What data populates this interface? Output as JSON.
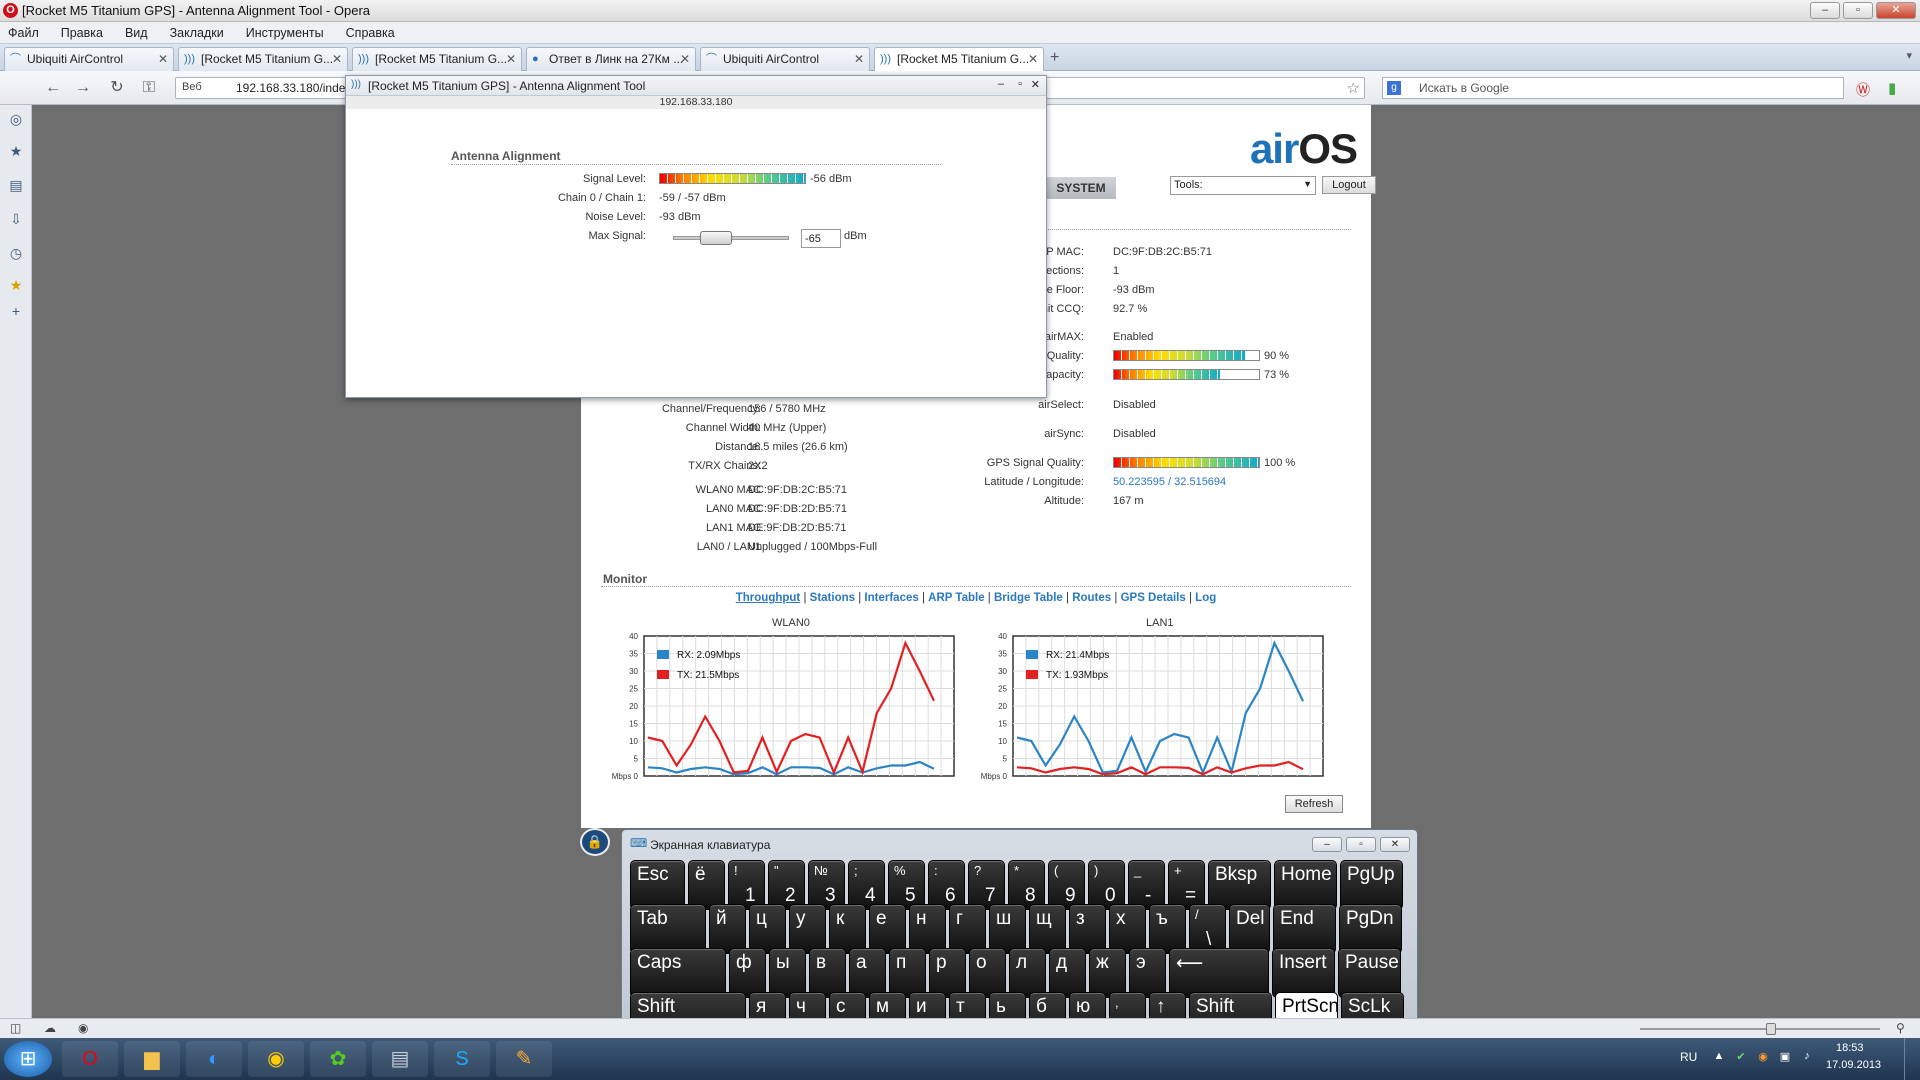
{
  "window": {
    "title": "[Rocket M5 Titanium GPS] - Antenna Alignment Tool - Opera",
    "min": "–",
    "max": "▫",
    "close": "✕"
  },
  "menu": [
    "Файл",
    "Правка",
    "Вид",
    "Закладки",
    "Инструменты",
    "Справка"
  ],
  "tabs": [
    {
      "label": "Ubiquiti AirControl"
    },
    {
      "label": "[Rocket M5 Titanium G..."
    },
    {
      "label": "[Rocket M5 Titanium G..."
    },
    {
      "label": "Ответ в Линк на 27Км ..."
    },
    {
      "label": "Ubiquiti AirControl"
    },
    {
      "label": "[Rocket M5 Titanium G..."
    }
  ],
  "address": {
    "badge": "Веб",
    "url": "192.168.33.180/inde",
    "search_placeholder": "Искать в Google"
  },
  "airos": {
    "logo_a": "air",
    "logo_b": "OS",
    "tab_system": "SYSTEM",
    "tools": "Tools:",
    "logout": "Logout",
    "right_labels": [
      "AP MAC:",
      "onnections:",
      "loise Floor:",
      "ansmit CCQ:",
      "airMAX:",
      "AX Quality:",
      "X Capacity:",
      "airSelect:",
      "airSync:",
      "GPS Signal Quality:",
      "Latitude / Longitude:",
      "Altitude:"
    ],
    "right_values": [
      "DC:9F:DB:2C:B5:71",
      "1",
      "-93 dBm",
      "92.7 %",
      "Enabled",
      "90 %",
      "73 %",
      "Disabled",
      "Disabled",
      "100 %",
      "50.223595 / 32.515694",
      "167 m"
    ],
    "left_labels": [
      "Channel/Frequency:",
      "Channel Width:",
      "Distance:",
      "TX/RX Chains:",
      "WLAN0 MAC",
      "LAN0 MAC",
      "LAN1 MAC",
      "LAN0 / LAN1"
    ],
    "left_values": [
      "156 / 5780 MHz",
      "40 MHz (Upper)",
      "16.5 miles (26.6 km)",
      "2X2",
      "DC:9F:DB:2C:B5:71",
      "DC:9F:DB:2D:B5:71",
      "DE:9F:DB:2D:B5:71",
      "Unplugged / 100Mbps-Full"
    ],
    "levels": {
      "airmax_quality": 0.9,
      "airmax_capacity": 0.73,
      "gps_quality": 1.0
    },
    "monitor": "Monitor",
    "links": [
      "Throughput",
      "Stations",
      "Interfaces",
      "ARP Table",
      "Bridge Table",
      "Routes",
      "GPS Details",
      "Log"
    ],
    "refresh": "Refresh"
  },
  "popup": {
    "title": "[Rocket M5 Titanium GPS] - Antenna Alignment Tool",
    "ip": "192.168.33.180",
    "section": "Antenna Alignment",
    "labels": [
      "Signal Level:",
      "Chain 0 / Chain 1:",
      "Noise Level:",
      "Max Signal:"
    ],
    "values": [
      "-56 dBm",
      "-59 / -57 dBm",
      "-93 dBm",
      ""
    ],
    "signal_level": 1.0,
    "max_value": "-65",
    "unit": "dBm"
  },
  "keyboard": {
    "title": "Экранная клавиатура",
    "rows": [
      [
        {
          "m": "Esc",
          "w": 55
        },
        {
          "m": "ё",
          "w": 37
        },
        {
          "s": "!",
          "b": "1",
          "w": 37
        },
        {
          "s": "\"",
          "b": "2",
          "w": 37
        },
        {
          "s": "№",
          "b": "3",
          "w": 37
        },
        {
          "s": ";",
          "b": "4",
          "w": 37
        },
        {
          "s": "%",
          "b": "5",
          "w": 37
        },
        {
          "s": ":",
          "b": "6",
          "w": 37
        },
        {
          "s": "?",
          "b": "7",
          "w": 37
        },
        {
          "s": "*",
          "b": "8",
          "w": 37
        },
        {
          "s": "(",
          "b": "9",
          "w": 37
        },
        {
          "s": ")",
          "b": "0",
          "w": 37
        },
        {
          "s": "_",
          "b": "-",
          "w": 37
        },
        {
          "s": "+",
          "b": "=",
          "w": 37
        },
        {
          "m": "Bksp",
          "w": 63
        },
        {
          "m": "Home",
          "w": 63
        },
        {
          "m": "PgUp",
          "w": 63
        }
      ],
      [
        {
          "m": "Tab",
          "w": 76
        },
        {
          "m": "й",
          "w": 37
        },
        {
          "m": "ц",
          "w": 37
        },
        {
          "m": "у",
          "w": 37
        },
        {
          "m": "к",
          "w": 37
        },
        {
          "m": "е",
          "w": 37
        },
        {
          "m": "н",
          "w": 37
        },
        {
          "m": "г",
          "w": 37
        },
        {
          "m": "ш",
          "w": 37
        },
        {
          "m": "щ",
          "w": 37
        },
        {
          "m": "з",
          "w": 37
        },
        {
          "m": "х",
          "w": 37
        },
        {
          "m": "ъ",
          "w": 37
        },
        {
          "s": "/",
          "b": "\\",
          "w": 37
        },
        {
          "m": "Del",
          "w": 41
        },
        {
          "m": "End",
          "w": 63
        },
        {
          "m": "PgDn",
          "w": 63
        }
      ],
      [
        {
          "m": "Caps",
          "w": 96
        },
        {
          "m": "ф",
          "w": 37
        },
        {
          "m": "ы",
          "w": 37
        },
        {
          "m": "в",
          "w": 37
        },
        {
          "m": "а",
          "w": 37
        },
        {
          "m": "п",
          "w": 37
        },
        {
          "m": "р",
          "w": 37
        },
        {
          "m": "о",
          "w": 37
        },
        {
          "m": "л",
          "w": 37
        },
        {
          "m": "д",
          "w": 37
        },
        {
          "m": "ж",
          "w": 37
        },
        {
          "m": "э",
          "w": 37
        },
        {
          "m": "⟵",
          "w": 100
        },
        {
          "m": "Insert",
          "w": 63
        },
        {
          "m": "Pause",
          "w": 63
        }
      ],
      [
        {
          "m": "Shift",
          "w": 116
        },
        {
          "m": "я",
          "w": 37
        },
        {
          "m": "ч",
          "w": 37
        },
        {
          "m": "с",
          "w": 37
        },
        {
          "m": "м",
          "w": 37
        },
        {
          "m": "и",
          "w": 37
        },
        {
          "m": "т",
          "w": 37
        },
        {
          "m": "ь",
          "w": 37
        },
        {
          "m": "б",
          "w": 37
        },
        {
          "m": "ю",
          "w": 37
        },
        {
          "s": ",",
          "b": ".",
          "w": 37
        },
        {
          "m": "↑",
          "w": 37
        },
        {
          "m": "Shift",
          "w": 83
        },
        {
          "m": "PrtScn",
          "w": 63,
          "white": true
        },
        {
          "m": "ScLk",
          "w": 63
        }
      ]
    ]
  },
  "tray": {
    "lang": "RU",
    "time": "18:53",
    "date": "17.09.2013"
  },
  "colors": {
    "rx": "#2a84c6",
    "tx": "#e32020",
    "accent": "#1d72b8"
  },
  "chart_data": [
    {
      "type": "line",
      "title": "WLAN0",
      "ylabel": "Mbps",
      "ylim": [
        0,
        40
      ],
      "yticks": [
        0,
        5,
        10,
        15,
        20,
        25,
        30,
        35,
        40
      ],
      "series": [
        {
          "name": "RX: 2.09Mbps",
          "values": [
            2.5,
            2.2,
            1,
            2,
            2.5,
            2,
            0.5,
            0.8,
            2.5,
            0.5,
            2.5,
            2.5,
            2.3,
            0.5,
            2.5,
            1,
            2.2,
            3,
            3,
            4,
            2.1
          ]
        },
        {
          "name": "TX: 21.5Mbps",
          "values": [
            11,
            10,
            3,
            9,
            17,
            10,
            1,
            1.5,
            11,
            1.2,
            10,
            12,
            11,
            1,
            11,
            1.2,
            18,
            25,
            38,
            30,
            21.5
          ]
        }
      ]
    },
    {
      "type": "line",
      "title": "LAN1",
      "ylabel": "Mbps",
      "ylim": [
        0,
        40
      ],
      "yticks": [
        0,
        5,
        10,
        15,
        20,
        25,
        30,
        35,
        40
      ],
      "series": [
        {
          "name": "RX: 21.4Mbps",
          "values": [
            11,
            10,
            3,
            9,
            17,
            10,
            1,
            1.5,
            11,
            1.2,
            10,
            12,
            11,
            1,
            11,
            1.2,
            18,
            25,
            38,
            30,
            21.4
          ]
        },
        {
          "name": "TX: 1.93Mbps",
          "values": [
            2.5,
            2.2,
            1,
            2,
            2.5,
            2,
            0.5,
            0.8,
            2.5,
            0.5,
            2.5,
            2.5,
            2.3,
            0.5,
            2.5,
            1,
            2.2,
            3,
            3,
            4,
            1.93
          ]
        }
      ]
    }
  ]
}
